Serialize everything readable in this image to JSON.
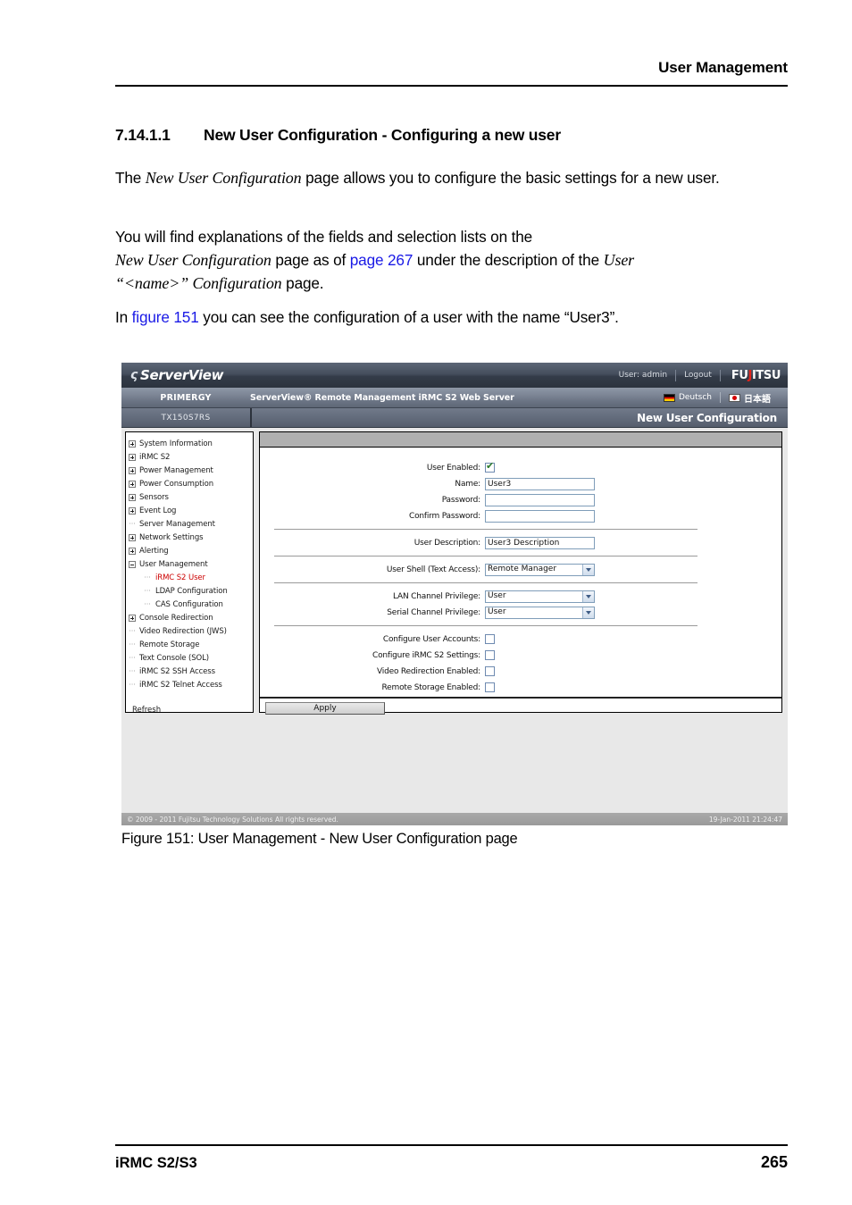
{
  "page": {
    "running_head": "User Management",
    "footer_left": "iRMC S2/S3",
    "footer_page": "265"
  },
  "section": {
    "number": "7.14.1.1",
    "title": "New User Configuration - Configuring a new user"
  },
  "paragraphs": {
    "p1_a": "The ",
    "p1_ital": "New User Configuration",
    "p1_b": " page allows you to configure the basic settings for a new user.",
    "p2_line1": "You will find explanations of the fields and selection lists on the",
    "p2_ital1": "New User Configuration",
    "p2_b": " page as of ",
    "p2_link": "page 267",
    "p2_c": " under the description of the ",
    "p2_ital2": "User",
    "p2_ital3": "“<name>” Configuration",
    "p2_d": " page.",
    "p3_a": "In ",
    "p3_link": "figure 151",
    "p3_b": " you can see the configuration of a user with the name “User3”."
  },
  "figure_caption": "Figure 151: User Management  - New User Configuration page",
  "screenshot": {
    "topbar": {
      "logo_mark": "ς",
      "logo_text": "ServerView",
      "user_label": "User: admin",
      "logout_label": "Logout",
      "brand": "FUJITSU",
      "brand_prefix": "FU",
      "brand_accent": "J",
      "brand_suffix": "ITSU"
    },
    "secondbar": {
      "primergy": "PRIMERGY",
      "product": "ServerView® Remote Management iRMC S2 Web Server",
      "lang_de": "Deutsch",
      "lang_jp": "日本語"
    },
    "thirdbar": {
      "node": "TX150S7RS",
      "page_title": "New User Configuration"
    },
    "tree": {
      "items": [
        {
          "label": "System Information",
          "type": "expandable",
          "level": 0,
          "active": false
        },
        {
          "label": "iRMC S2",
          "type": "expandable",
          "level": 0,
          "active": false
        },
        {
          "label": "Power Management",
          "type": "expandable",
          "level": 0,
          "active": false
        },
        {
          "label": "Power Consumption",
          "type": "expandable",
          "level": 0,
          "active": false
        },
        {
          "label": "Sensors",
          "type": "expandable",
          "level": 0,
          "active": false
        },
        {
          "label": "Event Log",
          "type": "expandable",
          "level": 0,
          "active": false
        },
        {
          "label": "Server Management",
          "type": "leaf",
          "level": 0,
          "active": false
        },
        {
          "label": "Network Settings",
          "type": "expandable",
          "level": 0,
          "active": false
        },
        {
          "label": "Alerting",
          "type": "expandable",
          "level": 0,
          "active": false
        },
        {
          "label": "User Management",
          "type": "expanded",
          "level": 0,
          "active": false
        },
        {
          "label": "iRMC S2 User",
          "type": "leaf",
          "level": 1,
          "active": true
        },
        {
          "label": "LDAP Configuration",
          "type": "leaf",
          "level": 1,
          "active": false
        },
        {
          "label": "CAS Configuration",
          "type": "leaf",
          "level": 1,
          "active": false
        },
        {
          "label": "Console Redirection",
          "type": "expandable",
          "level": 0,
          "active": false
        },
        {
          "label": "Video Redirection (JWS)",
          "type": "leaf",
          "level": 0,
          "active": false
        },
        {
          "label": "Remote Storage",
          "type": "leaf",
          "level": 0,
          "active": false
        },
        {
          "label": "Text Console (SOL)",
          "type": "leaf",
          "level": 0,
          "active": false
        },
        {
          "label": "iRMC S2 SSH Access",
          "type": "leaf",
          "level": 0,
          "active": false
        },
        {
          "label": "iRMC S2 Telnet Access",
          "type": "leaf",
          "level": 0,
          "active": false
        }
      ],
      "refresh": "Refresh"
    },
    "form": {
      "user_enabled_label": "User Enabled:",
      "user_enabled_checked": true,
      "name_label": "Name:",
      "name_value": "User3",
      "password_label": "Password:",
      "password_value": "",
      "confirm_password_label": "Confirm Password:",
      "confirm_password_value": "",
      "user_description_label": "User Description:",
      "user_description_value": "User3 Description",
      "user_shell_label": "User Shell (Text Access):",
      "user_shell_value": "Remote Manager",
      "lan_privilege_label": "LAN Channel Privilege:",
      "lan_privilege_value": "User",
      "serial_privilege_label": "Serial Channel Privilege:",
      "serial_privilege_value": "User",
      "configure_user_accounts_label": "Configure User Accounts:",
      "configure_user_accounts_checked": false,
      "configure_irmc_label": "Configure iRMC S2 Settings:",
      "configure_irmc_checked": false,
      "video_redirection_label": "Video Redirection Enabled:",
      "video_redirection_checked": false,
      "remote_storage_label": "Remote Storage Enabled:",
      "remote_storage_checked": false,
      "apply_label": "Apply"
    },
    "footer": {
      "copyright": "© 2009 - 2011 Fujitsu Technology Solutions All rights reserved.",
      "timestamp": "19-Jan-2011 21:24:47"
    }
  },
  "colors": {
    "link": "#1a1ae6",
    "tree_active": "#cc0000",
    "brand_red": "#e2231a"
  }
}
